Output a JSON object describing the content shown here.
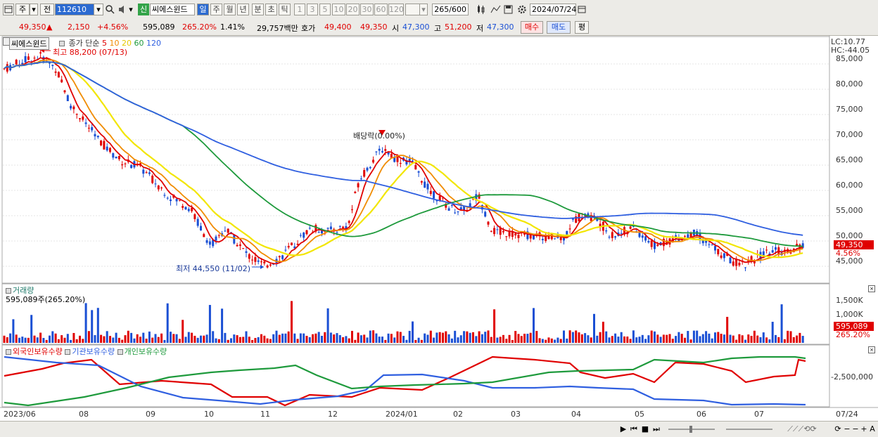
{
  "toolbar": {
    "period_type": "주",
    "jeon": "전",
    "code": "112610",
    "new_badge": "신",
    "stock_name": "씨에스윈드",
    "periods": [
      "일",
      "주",
      "월",
      "년",
      "분",
      "초",
      "틱"
    ],
    "active_period": "일",
    "minutes": [
      "1",
      "3",
      "5",
      "10",
      "20",
      "30",
      "60",
      "120"
    ],
    "count_value": "265",
    "count_total": "/600",
    "date": "2024/07/24"
  },
  "quote": {
    "price": "49,350",
    "change_arrow": "▲",
    "change": "2,150",
    "change_pct": "+4.56%",
    "volume": "595,089",
    "volume_ratio": "265.20%",
    "turnover_pct": "1.41%",
    "trade_value": "29,757백만",
    "hoga_label": "호가",
    "ask": "49,400",
    "bid": "49,350",
    "open_label": "시",
    "open": "47,300",
    "high_label": "고",
    "high": "51,200",
    "low_label": "저",
    "low": "47,300",
    "buy_label": "매수",
    "sell_label": "매도",
    "avg_label": "평"
  },
  "price_pane": {
    "stock_tag": "씨에스윈드",
    "ma_label": "종가 단순",
    "ma_periods": [
      "5",
      "10",
      "20",
      "60",
      "120"
    ],
    "ma_colors": [
      "#e00000",
      "#f08c00",
      "#f2e600",
      "#1e9a3c",
      "#2f5fe0"
    ],
    "lc": "LC:10.77",
    "hc": "HC:-44.05",
    "max_annotation": "최고 88,200 (07/13)",
    "min_annotation": "최저 44,550 (11/02)",
    "dividend_annotation": "배당락(0.00%)",
    "y_ticks": [
      "85,000",
      "80,000",
      "75,000",
      "70,000",
      "65,000",
      "60,000",
      "55,000",
      "50,000",
      "45,000"
    ],
    "current_price_tag": "49,350",
    "current_pct_tag": "4.56%"
  },
  "volume_pane": {
    "title": "거래량",
    "value_text": "595,089주(265.20%)",
    "y_ticks": [
      "1,500K",
      "1,000K"
    ],
    "current_tag": "595,089",
    "current_pct_tag": "265.20%"
  },
  "holdings_pane": {
    "legend": [
      "외국인보유수량",
      "기관보유수량",
      "개인보유수량"
    ],
    "legend_colors": [
      "#e00000",
      "#2f5fe0",
      "#1e9a3c"
    ],
    "y_tick": "-2,500,000"
  },
  "x_axis": [
    "2023/06",
    "08",
    "09",
    "10",
    "11",
    "12",
    "2024/01",
    "02",
    "03",
    "04",
    "05",
    "06",
    "07",
    "07/24"
  ],
  "colors": {
    "up": "#e00000",
    "down": "#1a4fd4",
    "accent": "#2b6ad1"
  }
}
